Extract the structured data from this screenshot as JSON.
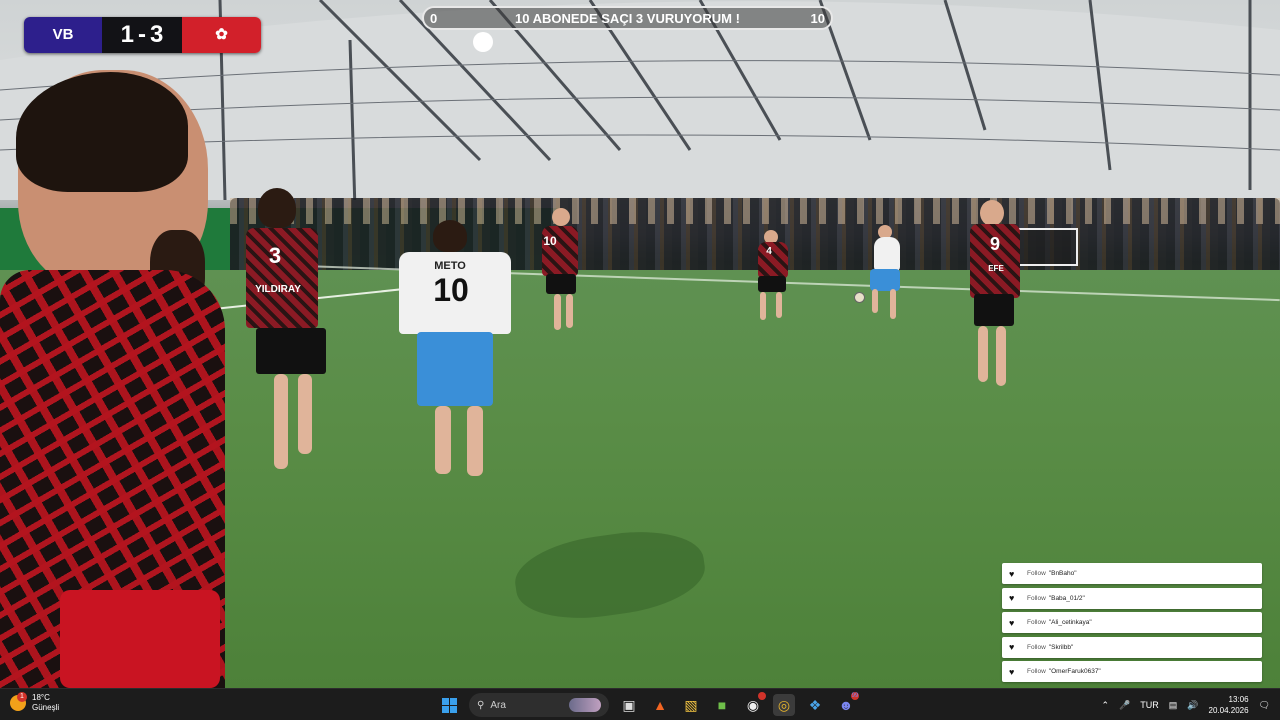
{
  "scoreboard": {
    "home_score": "1",
    "separator": "-",
    "away_score": "3",
    "home_color": "#2d1f8c",
    "away_color": "#d2202a",
    "home_crest": "VB",
    "away_crest": "✿"
  },
  "goal_bar": {
    "title": "10 ABONEDE SAÇI 3 VURUYORUM !",
    "current": "0",
    "target": "10",
    "progress": 0.0
  },
  "players": [
    {
      "number": "3",
      "name": "YILDIRAY"
    },
    {
      "number": "10",
      "name": "METO"
    },
    {
      "number": "10",
      "name": ""
    },
    {
      "number": "4",
      "name": ""
    },
    {
      "number": "9",
      "name": "EFE"
    }
  ],
  "alerts": [
    {
      "prefix": "Follow",
      "user": "\"BnBaho\""
    },
    {
      "prefix": "Follow",
      "user": "\"Baba_01/2\""
    },
    {
      "prefix": "Follow",
      "user": "\"Ali_cetinkaya\""
    },
    {
      "prefix": "Follow",
      "user": "\"Skrilbb\""
    },
    {
      "prefix": "Follow",
      "user": "\"OmerFaruk0637\""
    }
  ],
  "taskbar": {
    "weather": {
      "temp": "18°C",
      "condition": "Güneşli",
      "badge": "1",
      "icon": "sun-icon"
    },
    "search_placeholder": "Ara",
    "apps": [
      "windows-start-icon",
      "search-icon",
      "task-view-icon",
      "brave-browser-icon",
      "file-explorer-icon",
      "minecraft-icon",
      "obs-icon",
      "chrome-icon",
      "blue-app-icon",
      "discord-icon"
    ],
    "discord_badge": "99",
    "language": "TUR",
    "time": "13:06",
    "date": "20.04.2026"
  }
}
